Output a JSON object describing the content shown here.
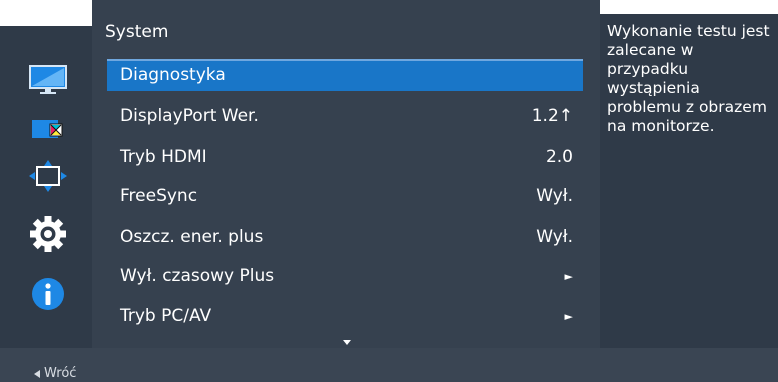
{
  "menu": {
    "title": "System",
    "items": [
      {
        "label": "Diagnostyka",
        "value": "",
        "selected": true
      },
      {
        "label": "DisplayPort Wer.",
        "value": "1.2↑"
      },
      {
        "label": "Tryb HDMI",
        "value": "2.0"
      },
      {
        "label": "FreeSync",
        "value": "Wył."
      },
      {
        "label": "Oszcz. ener. plus",
        "value": "Wył."
      },
      {
        "label": "Wył. czasowy Plus",
        "value": "►"
      },
      {
        "label": "Tryb PC/AV",
        "value": "►"
      }
    ]
  },
  "sidebar": {
    "icons": [
      "monitor-icon",
      "color-icon",
      "resize-icon",
      "gear-icon",
      "info-icon"
    ]
  },
  "help": {
    "text": "Wykonanie testu jest zalecane w przypadku wystąpienia problemu z obrazem na monitorze."
  },
  "bottom": {
    "back_label": "Wróć"
  },
  "colors": {
    "accent": "#1976c8",
    "panel": "#36414f",
    "sidebar": "#2f3a48",
    "bottom_bar": "#3a4553",
    "info_blue": "#1e88e5"
  }
}
